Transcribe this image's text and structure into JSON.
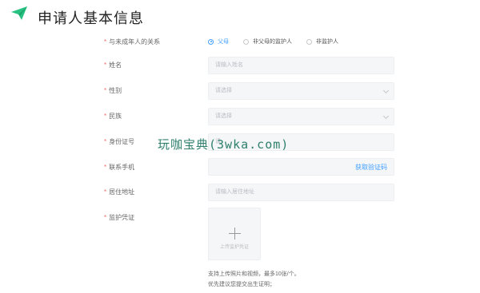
{
  "header": {
    "title": "申请人基本信息",
    "accent": "#27c281"
  },
  "form": {
    "relation": {
      "label": "与未成年人的关系",
      "options": [
        {
          "label": "父母",
          "selected": true
        },
        {
          "label": "非父母的监护人",
          "selected": false
        },
        {
          "label": "非监护人",
          "selected": false
        }
      ]
    },
    "name": {
      "label": "姓名",
      "placeholder": "请输入姓名"
    },
    "gender": {
      "label": "性别",
      "placeholder": "请选择"
    },
    "ethnicity": {
      "label": "民族",
      "placeholder": "请选择"
    },
    "id_number": {
      "label": "身份证号",
      "placeholder": "请"
    },
    "phone": {
      "label": "联系手机",
      "code_button": "获取验证码"
    },
    "address": {
      "label": "居住地址",
      "placeholder": "请输入居住地址"
    },
    "proof": {
      "label": "监护凭证",
      "upload_text": "上传监护凭证",
      "hint_line1": "支持上传照片和视频，最多10张/个。",
      "hint_line2": "优先建议您提交出生证明；"
    },
    "required_color": "#f56c6c",
    "link_color": "#409eff"
  },
  "watermark": {
    "text": "玩咖宝典(3wka.com)"
  }
}
